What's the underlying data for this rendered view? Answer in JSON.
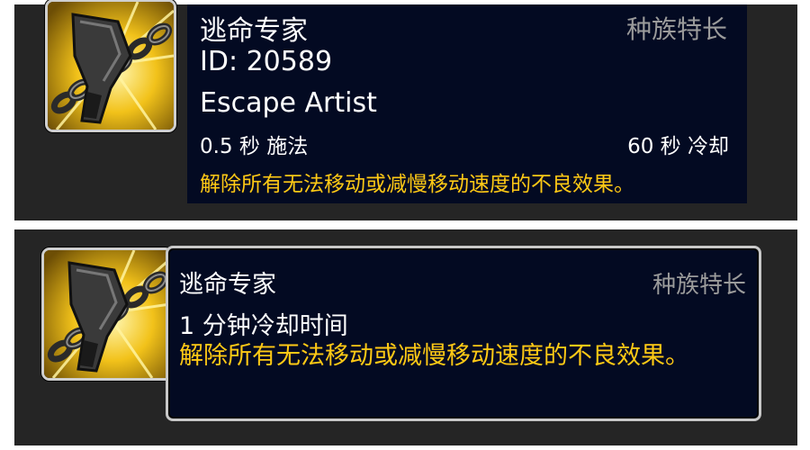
{
  "top_tooltip": {
    "spell_name": "逃命专家",
    "category": "种族特长",
    "spell_id": "ID: 20589",
    "english_name": "Escape Artist",
    "cast_time": "0.5 秒 施法",
    "cooldown": "60 秒 冷却",
    "description": "解除所有无法移动或减慢移动速度的不良效果。",
    "icon": "escape-artist-icon"
  },
  "bottom_tooltip": {
    "spell_name": "逃命专家",
    "category": "种族特长",
    "cooldown": "1 分钟冷却时间",
    "description": "解除所有无法移动或减慢移动速度的不良效果。",
    "icon": "escape-artist-icon"
  },
  "colors": {
    "panel_bg": "#252525",
    "tooltip_bg": "#030a22",
    "text_white": "#ffffff",
    "text_grey": "#9b9b9b",
    "text_gold": "#ffc915",
    "frame_border": "#cfcfcf"
  }
}
